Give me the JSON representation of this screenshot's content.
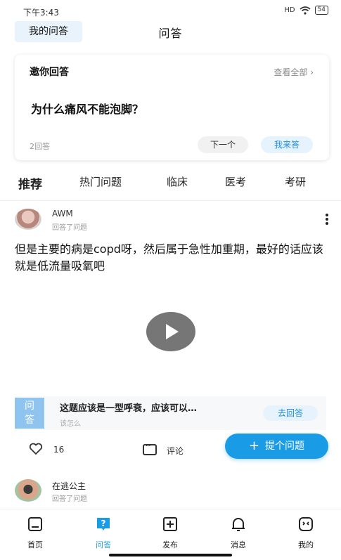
{
  "status_bar": {
    "time": "下午3:43",
    "signal": "HD",
    "wifi": "wifi",
    "battery": "54"
  },
  "header": {
    "my_answers": "我的问答",
    "title": "问答"
  },
  "invite_card": {
    "title": "邀你回答",
    "view_all": "查看全部 ›",
    "question": "为什么痛风不能泡脚？",
    "answer_count": "2回答",
    "next": "下一个",
    "answer_now": "我来答"
  },
  "tabs": [
    {
      "label": "推荐",
      "active": true
    },
    {
      "label": "热门问题",
      "active": false
    },
    {
      "label": "临床",
      "active": false
    },
    {
      "label": "医考",
      "active": false
    },
    {
      "label": "考研",
      "active": false
    }
  ],
  "post": {
    "username": "AWM",
    "subtitle": "回答了问题",
    "text": "但是主要的病是copd呀，然后属于急性加重期，最好的话应该就是低流量吸氧吧",
    "related": {
      "badge_line1": "问",
      "badge_line2": "答",
      "question": "这题应该是一型呼衰，应该可以…",
      "sub": "该怎么",
      "go_answer": "去回答"
    },
    "likes": "16",
    "comment": "评论"
  },
  "ask_button": {
    "plus": "+",
    "label": "提个问题"
  },
  "post2": {
    "username": "在逃公主",
    "subtitle": "回答了问题"
  },
  "bottom_nav": [
    {
      "label": "首页",
      "icon": "home-icon",
      "active": false
    },
    {
      "label": "问答",
      "icon": "qa-icon",
      "active": true
    },
    {
      "label": "发布",
      "icon": "publish-icon",
      "active": false
    },
    {
      "label": "消息",
      "icon": "bell-icon",
      "active": false
    },
    {
      "label": "我的",
      "icon": "profile-icon",
      "active": false
    }
  ],
  "colors": {
    "accent": "#1a9be6",
    "badge": "#8fc4ee"
  }
}
